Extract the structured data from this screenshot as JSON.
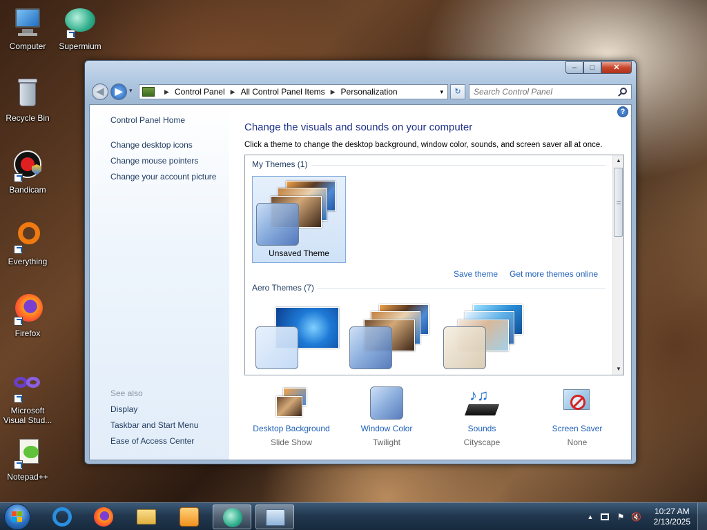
{
  "desktop": {
    "icons": [
      {
        "label": "Computer"
      },
      {
        "label": "Supermium"
      },
      {
        "label": "Recycle Bin"
      },
      {
        "label": "Bandicam"
      },
      {
        "label": "Everything"
      },
      {
        "label": "Firefox"
      },
      {
        "label": "Microsoft Visual Stud..."
      },
      {
        "label": "Notepad++"
      }
    ]
  },
  "window": {
    "controls": {
      "minimize": "–",
      "maximize": "□",
      "close": "✕"
    },
    "nav": {
      "back": "◀",
      "forward": "▶",
      "dropdown": "▾"
    },
    "address": {
      "crumbs": [
        "Control Panel",
        "All Control Panel Items",
        "Personalization"
      ],
      "separator": "▶",
      "dropdown": "▾"
    },
    "refresh": "↻",
    "search": {
      "placeholder": "Search Control Panel"
    },
    "left_pane": {
      "home": "Control Panel Home",
      "links": [
        "Change desktop icons",
        "Change mouse pointers",
        "Change your account picture"
      ],
      "see_also_title": "See also",
      "see_also": [
        "Display",
        "Taskbar and Start Menu",
        "Ease of Access Center"
      ]
    },
    "main": {
      "help": "?",
      "title": "Change the visuals and sounds on your computer",
      "subtitle": "Click a theme to change the desktop background, window color, sounds, and screen saver all at once.",
      "my_themes_title": "My Themes (1)",
      "unsaved_theme": "Unsaved Theme",
      "save_theme": "Save theme",
      "get_more": "Get more themes online",
      "aero_themes_title": "Aero Themes (7)",
      "scroll_up": "▲",
      "scroll_down": "▼",
      "bottom_items": [
        {
          "label": "Desktop Background",
          "value": "Slide Show"
        },
        {
          "label": "Window Color",
          "value": "Twilight"
        },
        {
          "label": "Sounds",
          "value": "Cityscape"
        },
        {
          "label": "Screen Saver",
          "value": "None"
        }
      ]
    }
  },
  "taskbar": {
    "tray": {
      "expand": "▲",
      "time": "10:27 AM",
      "date": "2/13/2025"
    }
  },
  "colors": {
    "link": "#1e5fb8",
    "heading": "#1e3287",
    "taskbar": "#22384f"
  }
}
